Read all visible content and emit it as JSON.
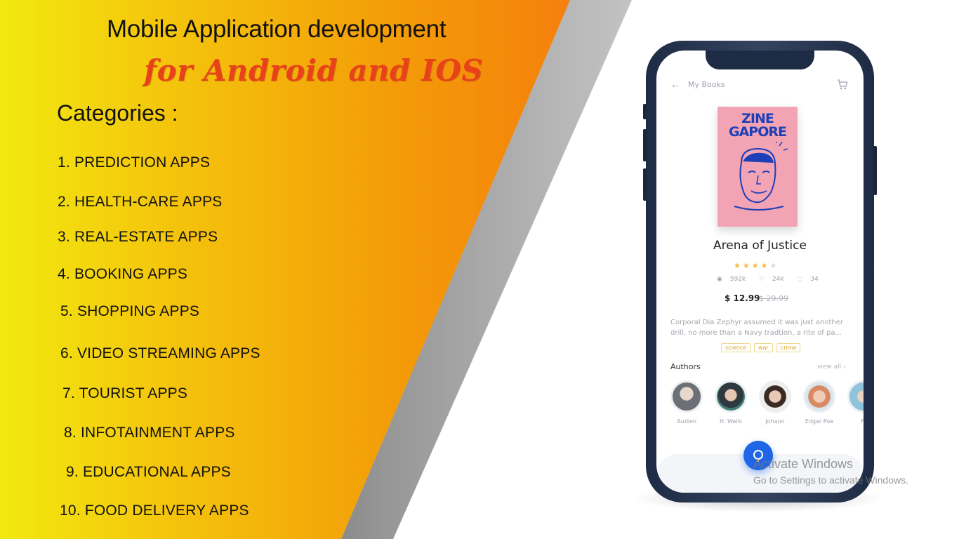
{
  "header": {
    "title": "Mobile Application development",
    "subtitle": "for Android and IOS"
  },
  "categories": {
    "heading": "Categories :",
    "items": [
      "1. PREDICTION APPS",
      "2. HEALTH-CARE APPS",
      "3. REAL-ESTATE APPS",
      "4. BOOKING APPS",
      "5. SHOPPING APPS",
      "6. VIDEO STREAMING APPS",
      "7. TOURIST APPS",
      "8. INFOTAINMENT APPS",
      "9. EDUCATIONAL APPS",
      "10. FOOD DELIVERY APPS"
    ]
  },
  "phone_app": {
    "nav_title": "My Books",
    "book_cover_title": "ZINE GAPORE",
    "book_name": "Arena of Justice",
    "rating": 4,
    "rating_max": 5,
    "views": "592k",
    "likes": "24k",
    "comments": "34",
    "price": "$ 12.99",
    "old_price": "$ 29.99",
    "description": "Corporal Dia Zephyr assumed it was just another drill, no more than a Navy tradtion, a rite of pa...",
    "tags": [
      "science",
      "war",
      "crime"
    ],
    "authors_label": "Authors",
    "view_all": "view all ›",
    "authors": [
      {
        "name": "Austen",
        "color": "#6b6f76"
      },
      {
        "name": "H. Wells",
        "color": "#2f3a40"
      },
      {
        "name": "Johann",
        "color": "#c9a28c"
      },
      {
        "name": "Edgar Poe",
        "color": "#d98a62"
      },
      {
        "name": "Fr",
        "color": "#8fc3d9"
      }
    ]
  },
  "watermark": {
    "title": "Activate Windows",
    "subtitle": "Go to Settings to activate Windows."
  },
  "colors": {
    "banner_start": "#f2e90f",
    "banner_end": "#f57f0c",
    "subtitle": "#e8421a",
    "phone_frame": "#1e2b44",
    "fab": "#1e66e6",
    "book_cover": "#f2a4b4"
  }
}
